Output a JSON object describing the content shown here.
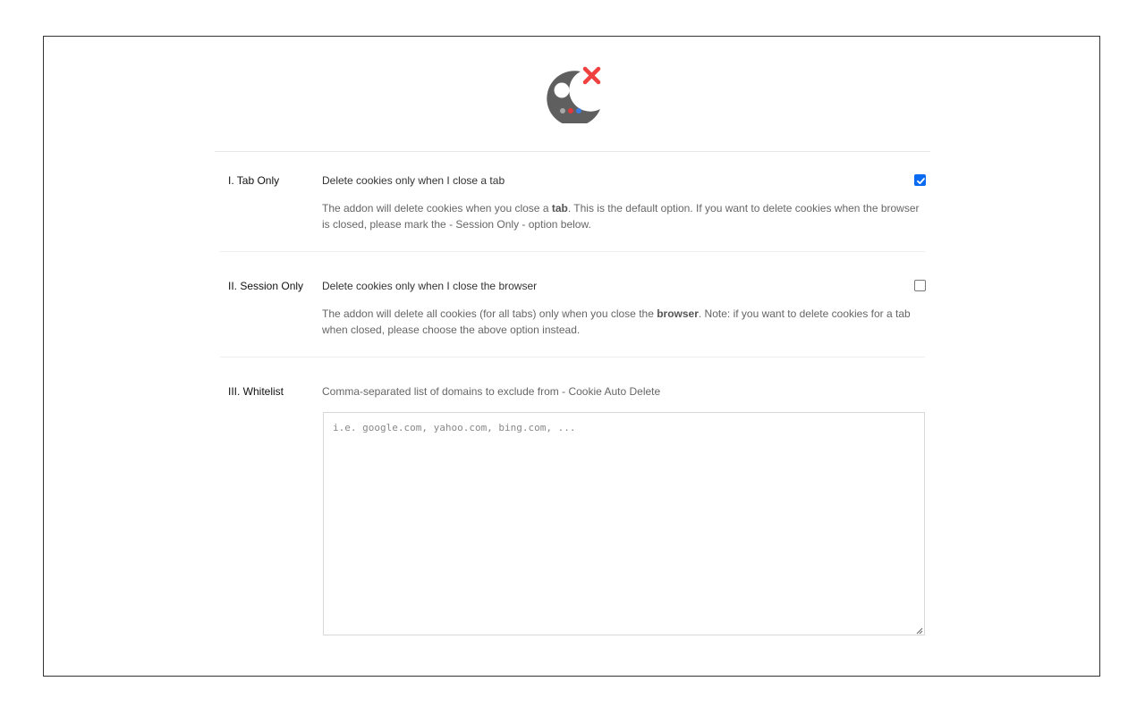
{
  "app": {
    "logo_icon": "cookie-delete-logo",
    "accent_color": "#0b6cf3",
    "logo_x_color": "#f04040"
  },
  "options": [
    {
      "label": "I. Tab Only",
      "title": "Delete cookies only when I close a tab",
      "desc_before": "The addon will delete cookies when you close a ",
      "desc_bold": "tab",
      "desc_after": ". This is the default option. If you want to delete cookies when the browser is closed, please mark the - Session Only - option below.",
      "checked": true
    },
    {
      "label": "II. Session Only",
      "title": "Delete cookies only when I close the browser",
      "desc_before": "The addon will delete all cookies (for all tabs) only when you close the ",
      "desc_bold": "browser",
      "desc_after": ". Note: if you want to delete cookies for a tab when closed, please choose the above option instead.",
      "checked": false
    }
  ],
  "whitelist": {
    "label": "III. Whitelist",
    "title": "Comma-separated list of domains to exclude from - Cookie Auto Delete",
    "placeholder": "i.e. google.com, yahoo.com, bing.com, ...",
    "value": ""
  }
}
